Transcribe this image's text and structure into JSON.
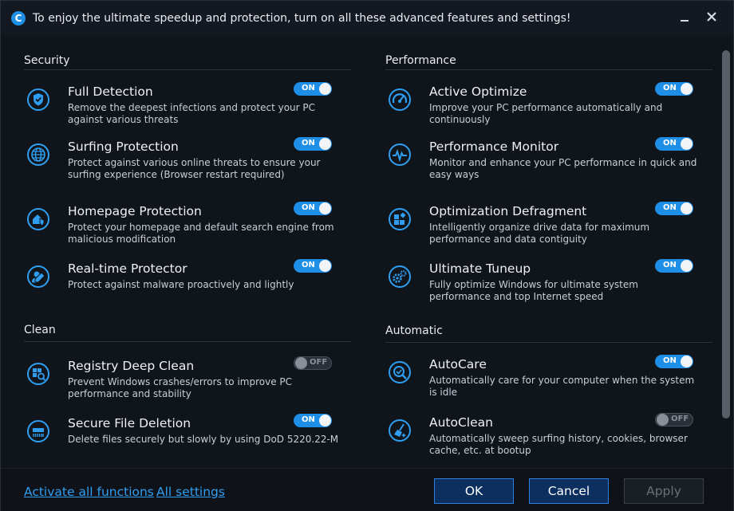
{
  "titlebar": {
    "title": "To enjoy the ultimate speedup and protection, turn on all these advanced features and settings!",
    "logo_letter": "C",
    "minimize_icon": "minimize-icon",
    "close_icon": "close-icon"
  },
  "sections": {
    "security": {
      "title": "Security",
      "items": [
        {
          "name": "Full Detection",
          "desc": "Remove the deepest infections and protect your PC against various threats",
          "toggle": "ON",
          "icon": "shield-check-icon"
        },
        {
          "name": "Surfing Protection",
          "desc": "Protect against various online threats to ensure your surfing experience (Browser restart required)",
          "toggle": "ON",
          "icon": "globe-icon"
        },
        {
          "name": "Homepage Protection",
          "desc": "Protect your homepage and default search engine from malicious modification",
          "toggle": "ON",
          "icon": "home-shield-icon"
        },
        {
          "name": "Real-time Protector",
          "desc": "Protect against malware proactively and lightly",
          "toggle": "ON",
          "icon": "realtime-protector-icon"
        }
      ]
    },
    "performance": {
      "title": "Performance",
      "items": [
        {
          "name": "Active Optimize",
          "desc": "Improve your PC performance automatically and continuously",
          "toggle": "ON",
          "icon": "speedometer-icon"
        },
        {
          "name": "Performance Monitor",
          "desc": "Monitor and enhance your PC performance in quick and easy ways",
          "toggle": "ON",
          "icon": "pulse-monitor-icon"
        },
        {
          "name": "Optimization Defragment",
          "desc": "Intelligently organize drive data for maximum performance and data contiguity",
          "toggle": "ON",
          "icon": "defragment-icon"
        },
        {
          "name": "Ultimate Tuneup",
          "desc": "Fully optimize Windows for ultimate system performance and top Internet speed",
          "toggle": "ON",
          "icon": "gears-icon"
        }
      ]
    },
    "clean": {
      "title": "Clean",
      "items": [
        {
          "name": "Registry Deep Clean",
          "desc": "Prevent Windows crashes/errors to improve PC performance and stability",
          "toggle": "OFF",
          "icon": "registry-clean-icon"
        },
        {
          "name": "Secure File Deletion",
          "desc": "Delete files securely but slowly by using DoD 5220.22-M",
          "toggle": "ON",
          "icon": "shredder-icon"
        }
      ]
    },
    "automatic": {
      "title": "Automatic",
      "items": [
        {
          "name": "AutoCare",
          "desc": "Automatically care for your computer when the system is idle",
          "toggle": "ON",
          "icon": "autocare-icon"
        },
        {
          "name": "AutoClean",
          "desc": "Automatically sweep surfing history, cookies, browser cache, etc. at bootup",
          "toggle": "OFF",
          "icon": "autoclean-broom-icon"
        }
      ]
    }
  },
  "footer": {
    "activate_all": "Activate all functions",
    "all_settings": "All settings",
    "ok": "OK",
    "cancel": "Cancel",
    "apply": "Apply"
  },
  "colors": {
    "accent": "#1e8ee6",
    "link": "#2f9ef0",
    "background": "#10141b"
  }
}
